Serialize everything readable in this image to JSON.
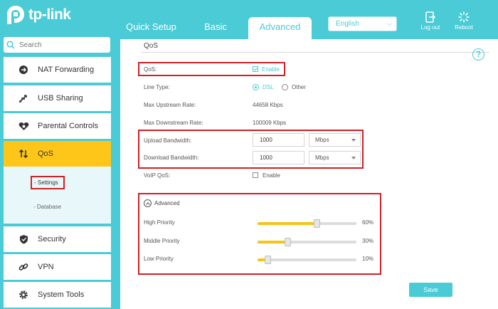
{
  "brand": {
    "name": "tp-link"
  },
  "header": {
    "tabs": [
      {
        "label": "Quick Setup"
      },
      {
        "label": "Basic"
      },
      {
        "label": "Advanced"
      }
    ],
    "language": "English",
    "logout_label": "Log out",
    "reboot_label": "Reboot"
  },
  "sidebar": {
    "search_placeholder": "Search",
    "items": [
      {
        "label": "NAT Forwarding",
        "icon": "nat-forwarding-icon"
      },
      {
        "label": "USB Sharing",
        "icon": "usb-icon"
      },
      {
        "label": "Parental Controls",
        "icon": "heart-icon"
      },
      {
        "label": "QoS",
        "icon": "updown-arrows-icon",
        "active": true
      },
      {
        "label": "Security",
        "icon": "shield-icon"
      },
      {
        "label": "VPN",
        "icon": "link-icon"
      },
      {
        "label": "System Tools",
        "icon": "gear-icon"
      }
    ],
    "sub_items": [
      {
        "label": "- Settings",
        "active": true
      },
      {
        "label": "- Database"
      }
    ]
  },
  "qos": {
    "section_title": "QoS",
    "help_label": "?",
    "qos_label": "QoS:",
    "enable_label": "Enable",
    "enable_checked": true,
    "line_type_label": "Line Type:",
    "line_type_options": [
      "DSL",
      "Other"
    ],
    "line_type_selected": "DSL",
    "max_up_label": "Max Upstream Rate:",
    "max_up_value": "44658 Kbps",
    "max_down_label": "Max Downstream Rate:",
    "max_down_value": "100009 Kbps",
    "upload_label": "Upload Bandwidth:",
    "upload_value": "1000",
    "upload_unit": "Mbps",
    "download_label": "Download Bandwidth:",
    "download_value": "1000",
    "download_unit": "Mbps",
    "voip_label": "VoIP QoS:",
    "voip_enable_label": "Enable",
    "voip_checked": false,
    "advanced_label": "Advanced",
    "priorities": [
      {
        "label": "High Priority",
        "percent": 60,
        "percent_label": "60%"
      },
      {
        "label": "Middle Priority",
        "percent": 30,
        "percent_label": "30%"
      },
      {
        "label": "Low Priority",
        "percent": 10,
        "percent_label": "10%"
      }
    ],
    "save_label": "Save"
  },
  "colors": {
    "accent": "#4acbd6",
    "active_tab": "#ffc61a",
    "slider_fill": "#f5c518",
    "highlight_box": "#cf2027"
  }
}
